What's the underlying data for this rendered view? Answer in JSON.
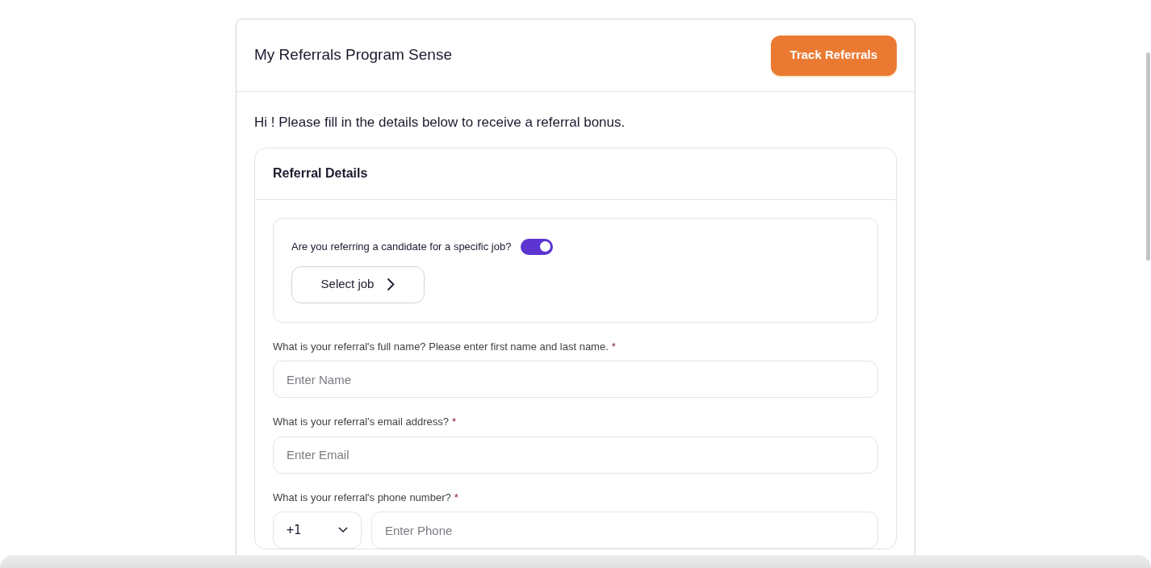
{
  "header": {
    "title": "My Referrals Program Sense",
    "button": "Track Referrals"
  },
  "greeting": "Hi ! Please fill in the details below to receive a referral bonus.",
  "section": {
    "title": "Referral Details",
    "job_box": {
      "question": "Are you referring a candidate for a specific job?",
      "toggle_on": true,
      "button": "Select job"
    },
    "fields": [
      {
        "kind": "text",
        "label": "What is your referral's full name? Please enter first name and last name.",
        "required_mark": "*",
        "placeholder": "Enter Name"
      },
      {
        "kind": "text",
        "label": "What is your referral’s email address?",
        "required_mark": "*",
        "placeholder": "Enter Email"
      },
      {
        "kind": "phone",
        "label": "What is your referral's phone number?",
        "required_mark": "*",
        "country_code": "+1",
        "placeholder": "Enter Phone"
      }
    ]
  }
}
